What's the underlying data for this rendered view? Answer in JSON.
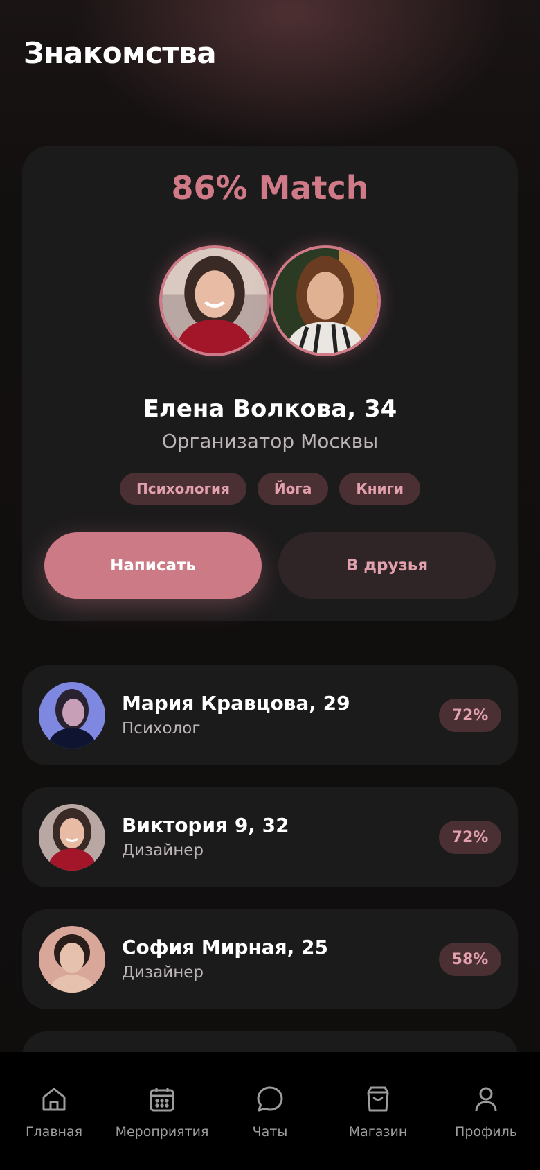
{
  "header": {
    "title": "Знакомства"
  },
  "featured": {
    "match": "86% Match",
    "name": "Елена Волкова, 34",
    "role": "Организатор Москвы",
    "tags": [
      "Психология",
      "Йога",
      "Книги"
    ],
    "write_label": "Написать",
    "friend_label": "В друзья"
  },
  "people": [
    {
      "name": "Мария Кравцова, 29",
      "role": "Психолог",
      "match": "72%"
    },
    {
      "name": "Виктория 9, 32",
      "role": "Дизайнер",
      "match": "72%"
    },
    {
      "name": "София Мирная, 25",
      "role": "Дизайнер",
      "match": "58%"
    }
  ],
  "nav": [
    {
      "label": "Главная",
      "icon": "home-icon"
    },
    {
      "label": "Мероприятия",
      "icon": "calendar-icon"
    },
    {
      "label": "Чаты",
      "icon": "chat-icon"
    },
    {
      "label": "Магазин",
      "icon": "bag-icon"
    },
    {
      "label": "Профиль",
      "icon": "user-icon"
    }
  ],
  "colors": {
    "accent": "#cc7a86",
    "card": "#1c1b1c",
    "chip": "#4a2f33"
  }
}
